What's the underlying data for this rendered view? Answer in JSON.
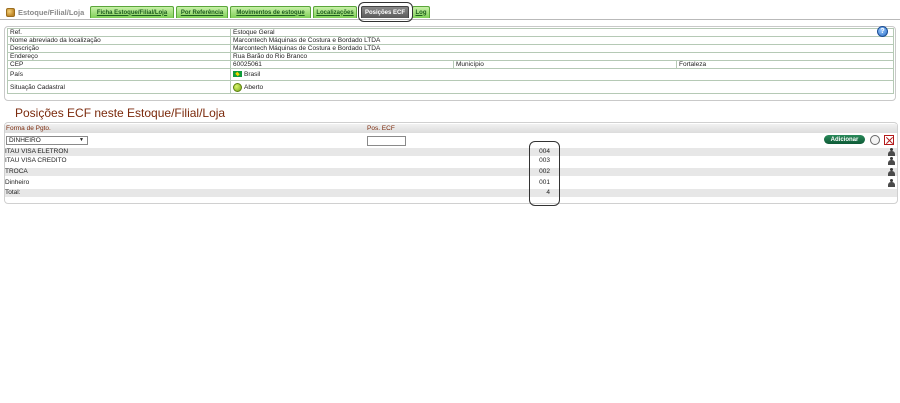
{
  "tabbar": {
    "app_title": "Estoque/Filial/Loja",
    "tabs": [
      {
        "label": "Ficha Estoque/Filial/Loja"
      },
      {
        "label": "Por Referência"
      },
      {
        "label": "Movimentos de estoque"
      },
      {
        "label": "Localizações"
      },
      {
        "label": "Posições ECF"
      },
      {
        "label": "Log"
      }
    ]
  },
  "info": {
    "rows": [
      {
        "label": "Ref.",
        "value": "Estoque Geral"
      },
      {
        "label": "Nome abreviado da localização",
        "value": "Marcontech Máquinas de Costura e Bordado LTDA"
      },
      {
        "label": "Descrição",
        "value": "Marcontech Máquinas de Costura e Bordado LTDA"
      },
      {
        "label": "Endereço",
        "value": "Rua Barão do Rio Branco"
      }
    ],
    "cep_label": "CEP",
    "cep_value": "60025061",
    "municipio_label": "Município",
    "municipio_value": "Fortaleza",
    "pais_label": "País",
    "pais_value": "Brasil",
    "situacao_label": "Situação Cadastral",
    "situacao_value": "Aberto"
  },
  "section_title": "Posições ECF neste Estoque/Filial/Loja",
  "ecf": {
    "col_forma": "Forma de Pgto.",
    "col_pos": "Pos. ECF",
    "select_value": "DINHEIRO",
    "add_label": "Adicionar",
    "rows": [
      {
        "name": "ITAU VISA ELETRON",
        "pos": "004"
      },
      {
        "name": "ITAU VISA CREDITO",
        "pos": "003"
      },
      {
        "name": "TROCA",
        "pos": "002"
      },
      {
        "name": "Dinheiro",
        "pos": "001"
      }
    ],
    "total_label": "Total:",
    "total_value": "4"
  }
}
